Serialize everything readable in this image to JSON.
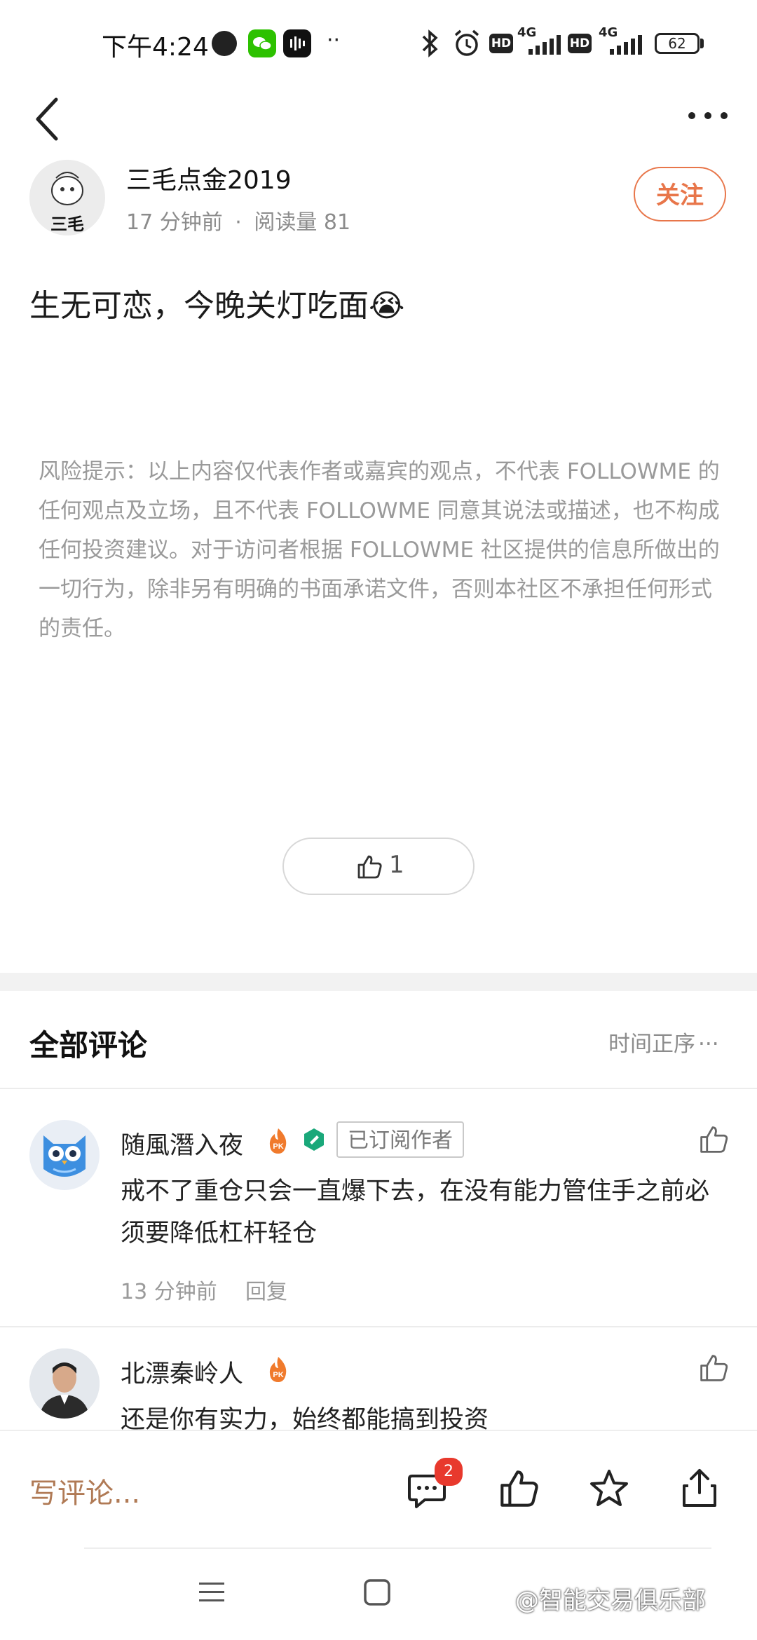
{
  "status_bar": {
    "time": "下午4:24",
    "network_1": "4G",
    "network_2": "4G",
    "battery": "62"
  },
  "author": {
    "name": "三毛点金2019",
    "time_ago": "17 分钟前",
    "separator": "·",
    "read_count": "阅读量 81",
    "avatar_text": "三毛",
    "follow_label": "关注"
  },
  "post": {
    "title": "生无可恋，今晚关灯吃面😭",
    "risk_notice": "风险提示：以上内容仅代表作者或嘉宾的观点，不代表 FOLLOWME 的任何观点及立场，且不代表 FOLLOWME 同意其说法或描述，也不构成任何投资建议。对于访问者根据 FOLLOWME 社区提供的信息所做出的一切行为，除非另有明确的书面承诺文件，否则本社区不承担任何形式的责任。",
    "like_count": "1"
  },
  "comments_section": {
    "title": "全部评论",
    "sort_label": "时间正序",
    "items": [
      {
        "name": "随風潛入夜",
        "pk_badge": "PK",
        "subscriber_badge": "已订阅作者",
        "text": "戒不了重仓只会一直爆下去，在没有能力管住手之前必须要降低杠杆轻仓",
        "time_ago": "13 分钟前",
        "reply_label": "回复"
      },
      {
        "name": "北漂秦岭人",
        "pk_badge": "PK",
        "text": "还是你有实力，始终都能搞到投资"
      }
    ]
  },
  "bottom_bar": {
    "write_comment": "写评论...",
    "comment_badge": "2"
  },
  "watermark": "@智能交易俱乐部",
  "colors": {
    "accent": "#e8764a",
    "write_comment": "#b07a55",
    "badge": "#e8392d"
  }
}
